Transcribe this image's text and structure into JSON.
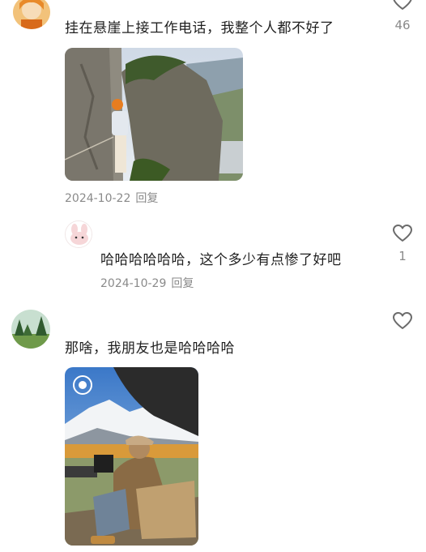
{
  "comments": [
    {
      "text": "挂在悬崖上接工作电话，我整个人都不好了",
      "date": "2024-10-22",
      "reply_label": "回复",
      "like_count": "46",
      "avatar_icon": "user-avatar-cartoon-orange",
      "image_icon": "cliff-climbing-photo"
    },
    {
      "text": "哈哈哈哈哈哈，这个多少有点惨了好吧",
      "date": "2024-10-29",
      "reply_label": "回复",
      "like_count": "1",
      "avatar_icon": "user-avatar-pink-bunny"
    },
    {
      "text": "那啥，我朋友也是哈哈哈哈",
      "date": "",
      "reply_label": "",
      "like_count": "",
      "avatar_icon": "user-avatar-forest",
      "image_icon": "mountain-camping-photo"
    }
  ],
  "colors": {
    "meta_text": "#8a8a8a",
    "heart_outline": "#6b6b6b"
  }
}
